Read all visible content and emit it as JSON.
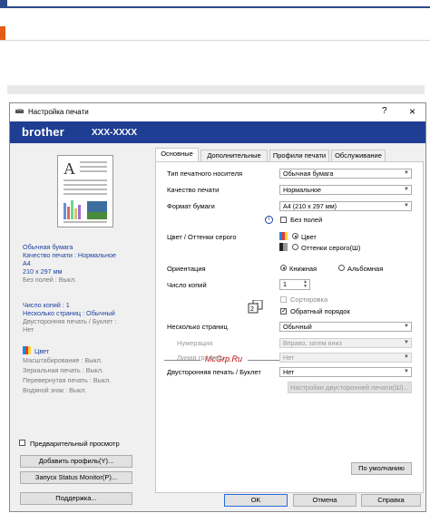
{
  "dialog": {
    "title": "Настройка печати",
    "help": "?",
    "close": "×",
    "brand": "brother",
    "model": "XXX-XXXX"
  },
  "left": {
    "media": "Обычная бумага",
    "quality": "Качество печати : Нормальное",
    "size": "A4",
    "dims": "210 x 297 мм",
    "borderless": "Без полей : Выкл.",
    "copies": "Число копий : 1",
    "pages": "Несколько страниц : Обычный",
    "duplex": "Двусторонняя печать / Буклет :",
    "duplex_val": "Нет",
    "color": "Цвет",
    "scale": "Масштабирование : Выкл.",
    "mirror": "Зеркальная печать : Выкл.",
    "reverse": "Перевернутая печать : Выкл.",
    "watermark": "Водяной знак : Выкл.",
    "preview_label": "Предварительный просмотр",
    "add_profile": "Добавить профиль(Y)...",
    "status_monitor": "Запуск Status Monitor(P)...",
    "support": "Поддержка..."
  },
  "tabs": [
    "Основные",
    "Дополнительные",
    "Профили печати",
    "Обслуживание"
  ],
  "form": {
    "media_label": "Тип печатного носителя",
    "media_value": "Обычная бумага",
    "quality_label": "Качество печати",
    "quality_value": "Нормальное",
    "size_label": "Формат бумаги",
    "size_value": "A4 (210 x 297 мм)",
    "borderless": "Без полей",
    "color_label": "Цвет / Оттенки серого",
    "color_opt": "Цвет",
    "gray_opt": "Оттенки серого(Ш)",
    "watermark_text": "McGrp.Ru",
    "orient_label": "Ориентация",
    "portrait": "Книжная",
    "landscape": "Альбомная",
    "copies_label": "Число копий",
    "copies_value": "1",
    "collate": "Сортировка",
    "reverse": "Обратный порядок",
    "multi_label": "Несколько страниц",
    "multi_value": "Обычный",
    "order_label": "Нумерация",
    "order_value": "Вправо, затем вниз",
    "border_label": "Линия границы",
    "border_value": "Нет",
    "duplex_label": "Двусторонняя печать / Буклет",
    "duplex_value": "Нет",
    "duplex_settings": "Настройки двусторонней печати(Ш)...",
    "default_btn": "По умолчанию"
  },
  "footer": {
    "ok": "OK",
    "cancel": "Отмена",
    "help": "Справка"
  },
  "colors": {
    "brand_bar": "#1f3e93",
    "accent": "#e35d16",
    "link_blue": "#1a3fa0"
  }
}
